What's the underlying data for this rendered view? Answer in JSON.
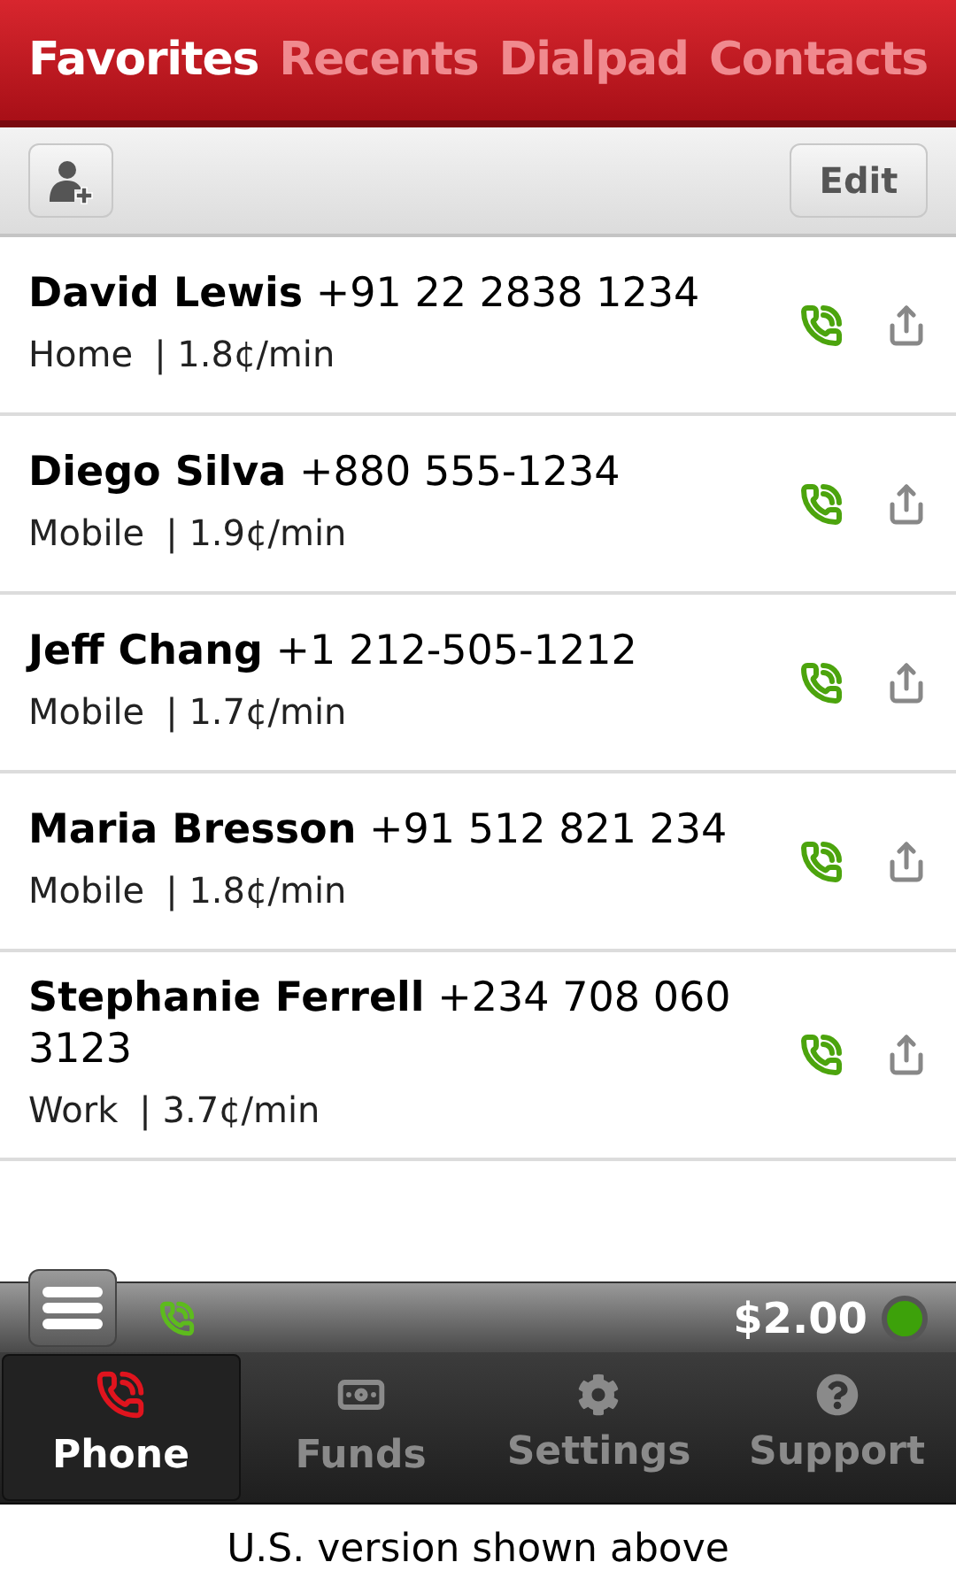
{
  "top_tabs": [
    {
      "label": "Favorites",
      "selected": true
    },
    {
      "label": "Recents",
      "selected": false
    },
    {
      "label": "Dialpad",
      "selected": false
    },
    {
      "label": "Contacts",
      "selected": false
    }
  ],
  "toolbar": {
    "edit_button": "Edit"
  },
  "favorites": [
    {
      "title": "**David Lewis** +91 22 2838 1234",
      "type": "Home",
      "rate": "| 1.8¢/min"
    },
    {
      "title": "**Diego Silva** +880 555-1234",
      "type": "Mobile",
      "rate": "| 1.9¢/min"
    },
    {
      "title": "**Jeff Chang** +1 212-505-1212",
      "type": "Mobile",
      "rate": "| 1.7¢/min"
    },
    {
      "title": "**Maria Bresson** +91 512 821 234",
      "type": "Mobile",
      "rate": "| 1.8¢/min"
    },
    {
      "title": "**Stephanie Ferrell** +234 708 060 3123",
      "type": "Work",
      "rate": "| 3.7¢/min"
    }
  ],
  "status_bar": {
    "balance": "$2.00",
    "connected": true
  },
  "bottom_tabs": [
    {
      "label": "Phone",
      "kind": "phone",
      "selected": true
    },
    {
      "label": "Funds",
      "kind": "funds",
      "selected": false
    },
    {
      "label": "Settings",
      "kind": "settings",
      "selected": false
    },
    {
      "label": "Support",
      "kind": "support",
      "selected": false
    }
  ],
  "caption": "U.S. version shown above"
}
